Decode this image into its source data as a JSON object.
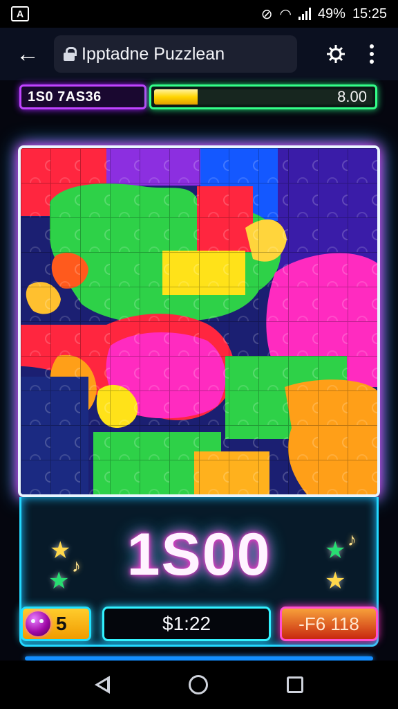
{
  "status_bar": {
    "left_badge": "A",
    "battery_percent": "49%",
    "time": "15:25",
    "icons": [
      "notification-muted-icon",
      "wifi-icon",
      "signal-icon"
    ]
  },
  "browser": {
    "url_text": "Ipptadne Puzzlean",
    "icons": [
      "back-arrow-icon",
      "lock-icon",
      "extension-icon",
      "more-menu-icon"
    ]
  },
  "top_hud": {
    "score_code": "1S0 7AS36",
    "progress_value": "8.00",
    "progress_fraction": 0.2
  },
  "board": {
    "title": "",
    "piece_colors": [
      "#ff263f",
      "#ff2bc0",
      "#8c2fe0",
      "#1458ff",
      "#2ed148",
      "#ffe219",
      "#ff9f18",
      "#1b1f72"
    ]
  },
  "score": {
    "value": "1S00"
  },
  "decor": {
    "stars": [
      "#ffd84c",
      "#28dd72",
      "#28dd72",
      "#ffd84c"
    ],
    "note_icon": "music-note-icon"
  },
  "bottom_hud": {
    "lives_value": "5",
    "money_value": "$1:22",
    "bonus_value": "-F6 118"
  },
  "nav": {
    "icons": [
      "nav-back-icon",
      "nav-home-icon",
      "nav-recent-icon"
    ]
  }
}
